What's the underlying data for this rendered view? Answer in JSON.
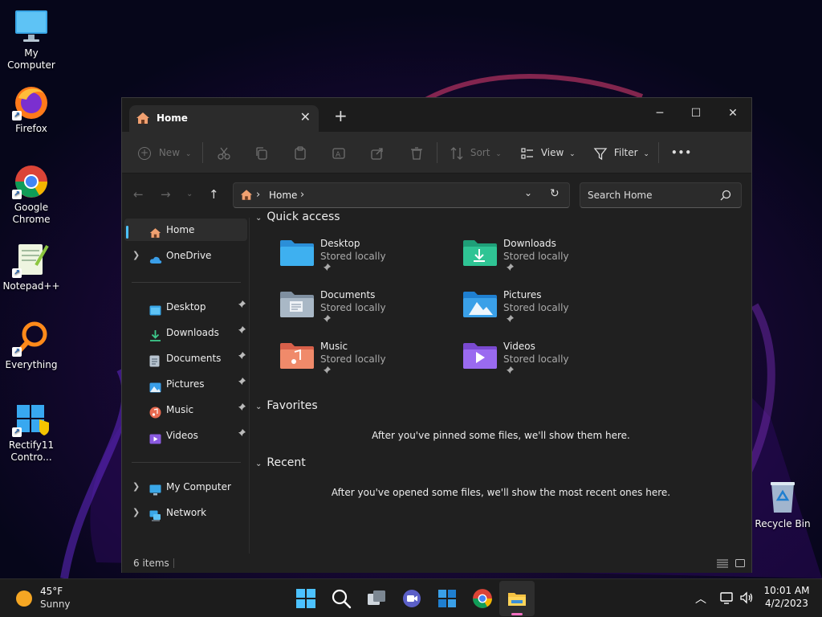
{
  "desktop": {
    "icons": [
      {
        "label": "My Computer"
      },
      {
        "label": "Firefox"
      },
      {
        "label": "Google Chrome"
      },
      {
        "label": "Notepad++"
      },
      {
        "label": "Everything"
      },
      {
        "label": "Rectify11 Contro..."
      },
      {
        "label": "Recycle Bin"
      }
    ]
  },
  "explorer": {
    "tab_title": "Home",
    "commands": {
      "new": "New",
      "sort": "Sort",
      "view": "View",
      "filter": "Filter",
      "more": "•••"
    },
    "address": {
      "location": "Home",
      "separator": "›"
    },
    "search": {
      "placeholder": "Search Home"
    },
    "nav": {
      "home": "Home",
      "onedrive": "OneDrive",
      "pinned": [
        "Desktop",
        "Downloads",
        "Documents",
        "Pictures",
        "Music",
        "Videos"
      ],
      "my_computer": "My Computer",
      "network": "Network"
    },
    "quick_access": {
      "title": "Quick access",
      "items": [
        {
          "name": "Desktop",
          "sub": "Stored locally"
        },
        {
          "name": "Downloads",
          "sub": "Stored locally"
        },
        {
          "name": "Documents",
          "sub": "Stored locally"
        },
        {
          "name": "Pictures",
          "sub": "Stored locally"
        },
        {
          "name": "Music",
          "sub": "Stored locally"
        },
        {
          "name": "Videos",
          "sub": "Stored locally"
        }
      ]
    },
    "favorites": {
      "title": "Favorites",
      "empty": "After you've pinned some files, we'll show them here."
    },
    "recent": {
      "title": "Recent",
      "empty": "After you've opened some files, we'll show the most recent ones here."
    },
    "status": {
      "count": "6 items"
    }
  },
  "taskbar": {
    "weather": {
      "temp": "45°F",
      "condition": "Sunny"
    },
    "clock": {
      "time": "10:01 AM",
      "date": "4/2/2023"
    }
  },
  "colors": {
    "accent": "#4cc2ff",
    "window_bg": "#202020",
    "toolbar_bg": "#2b2b2b",
    "taskbar_bg": "#1c1c1c"
  }
}
